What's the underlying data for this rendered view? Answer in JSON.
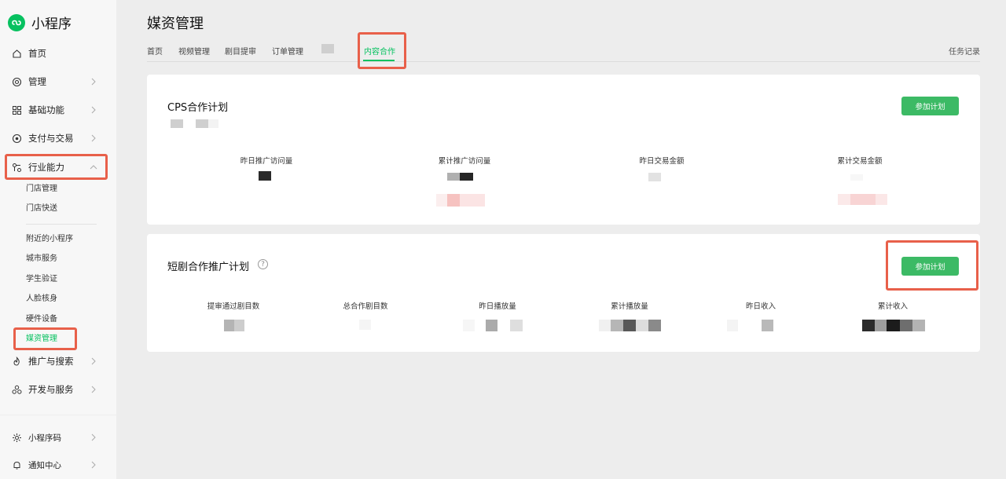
{
  "sidebar": {
    "logo_text": "小程序",
    "items": [
      {
        "label": "首页",
        "icon": "home-icon",
        "has_arrow": false
      },
      {
        "label": "管理",
        "icon": "gear-icon",
        "has_arrow": true
      },
      {
        "label": "基础功能",
        "icon": "grid-icon",
        "has_arrow": true
      },
      {
        "label": "支付与交易",
        "icon": "payment-icon",
        "has_arrow": true
      },
      {
        "label": "行业能力",
        "icon": "industry-icon",
        "has_arrow": true,
        "expanded": true
      },
      {
        "label": "推广与搜索",
        "icon": "promote-icon",
        "has_arrow": true
      },
      {
        "label": "开发与服务",
        "icon": "develop-icon",
        "has_arrow": true
      }
    ],
    "sub_items": [
      "门店管理",
      "门店快送",
      "附近的小程序",
      "城市服务",
      "学生验证",
      "人脸核身",
      "硬件设备",
      "媒资管理"
    ],
    "active_sub_item": "媒资管理",
    "bottom_items": [
      {
        "label": "小程序码",
        "icon": "qrcode-icon"
      },
      {
        "label": "通知中心",
        "icon": "bell-icon"
      }
    ]
  },
  "header": {
    "title": "媒资管理",
    "tabs": [
      "首页",
      "视频管理",
      "剧目提审",
      "订单管理",
      "内容合作"
    ],
    "active_tab": "内容合作",
    "task_record": "任务记录"
  },
  "cps_card": {
    "title": "CPS合作计划",
    "button_label": "参加计划",
    "stats": [
      "昨日推广访问量",
      "累计推广访问量",
      "昨日交易金额",
      "累计交易金额"
    ]
  },
  "drama_card": {
    "title": "短剧合作推广计划",
    "help_icon": "question-circle-icon",
    "button_label": "参加计划",
    "stats": [
      "提审通过剧目数",
      "总合作剧目数",
      "昨日播放量",
      "累计播放量",
      "昨日收入",
      "累计收入"
    ]
  },
  "colors": {
    "accent": "#07c160",
    "button": "#3cba65",
    "highlight": "#e8604a"
  }
}
